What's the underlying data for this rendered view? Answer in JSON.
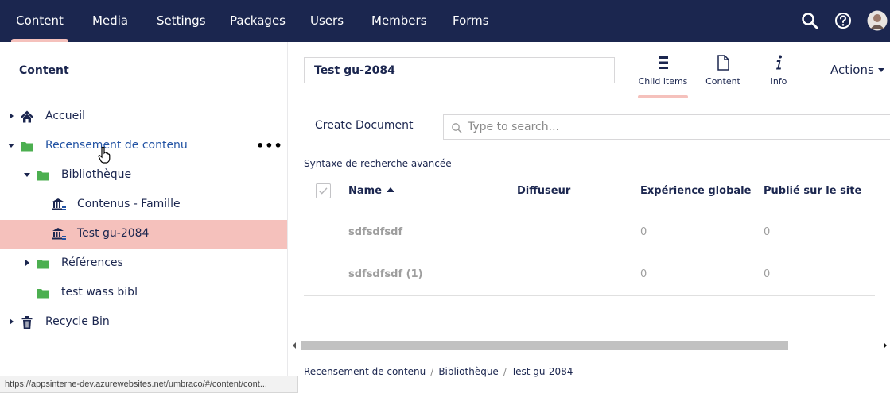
{
  "header": {
    "nav": [
      {
        "label": "Content",
        "active": true
      },
      {
        "label": "Media"
      },
      {
        "label": "Settings"
      },
      {
        "label": "Packages"
      },
      {
        "label": "Users"
      },
      {
        "label": "Members"
      },
      {
        "label": "Forms"
      }
    ],
    "icons": [
      "search-icon",
      "help-icon",
      "user-avatar"
    ]
  },
  "sidebar": {
    "title": "Content",
    "tree": [
      {
        "label": "Accueil",
        "icon": "home-icon",
        "expander": "collapsed"
      },
      {
        "label": "Recensement de contenu",
        "icon": "folder-icon",
        "expander": "expanded",
        "has_actions_menu": true
      },
      {
        "label": "Bibliothèque",
        "icon": "folder-icon",
        "expander": "expanded"
      },
      {
        "label": "Contenus - Famille",
        "icon": "library-icon"
      },
      {
        "label": "Test gu-2084",
        "icon": "library-icon",
        "selected": true
      },
      {
        "label": "Références",
        "icon": "folder-icon",
        "expander": "collapsed"
      },
      {
        "label": "test wass bibl",
        "icon": "folder-icon"
      },
      {
        "label": "Recycle Bin",
        "icon": "trash-icon",
        "expander": "collapsed"
      }
    ],
    "status_url": "https://appsinterne-dev.azurewebsites.net/umbraco/#/content/cont..."
  },
  "editor": {
    "name_value": "Test gu-2084",
    "apps": [
      {
        "label": "Child items",
        "icon": "list-icon",
        "active": true
      },
      {
        "label": "Content",
        "icon": "document-icon"
      },
      {
        "label": "Info",
        "icon": "info-icon"
      }
    ],
    "actions_label": "Actions"
  },
  "listview": {
    "create_label": "Create Document",
    "search_placeholder": "Type to search...",
    "advanced_search": "Syntaxe de recherche avancée",
    "columns": [
      "Name",
      "Diffuseur",
      "Expérience globale",
      "Publié sur le site"
    ],
    "sort": {
      "column": "Name",
      "direction": "ascending"
    },
    "rows": [
      {
        "name": "sdfsdfsdf",
        "diffuseur": "",
        "experience": "0",
        "publie": "0"
      },
      {
        "name": "sdfsdfsdf (1)",
        "diffuseur": "",
        "experience": "0",
        "publie": "0"
      }
    ]
  },
  "breadcrumb": {
    "items": [
      "Recensement de contenu",
      "Bibliothèque",
      "Test gu-2084"
    ]
  },
  "colors": {
    "header_bg": "#1b264f",
    "accent": "#f5c1bc",
    "folder": "#4caf50",
    "text_dark": "#1b264f"
  }
}
